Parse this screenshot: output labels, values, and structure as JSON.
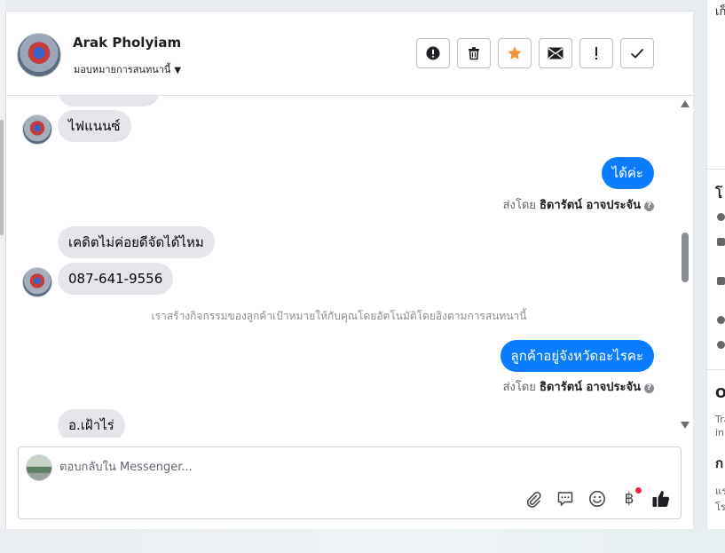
{
  "header": {
    "name": "Arak Pholyiam",
    "assign_label": "มอบหมายการสนทนานี้",
    "toolbar": [
      {
        "name": "spam-button",
        "icon": "alert-circle-icon"
      },
      {
        "name": "delete-button",
        "icon": "trash-icon"
      },
      {
        "name": "star-button",
        "icon": "star-icon"
      },
      {
        "name": "mark-unread-button",
        "icon": "envelope-icon"
      },
      {
        "name": "follow-up-button",
        "icon": "exclamation-icon"
      },
      {
        "name": "mark-done-button",
        "icon": "check-icon"
      }
    ]
  },
  "messages": {
    "m1": "ไฟแนนซ์",
    "m2": "ได้ค่ะ",
    "m2_sent_prefix": "ส่งโดย",
    "m2_sent_name": "ธิดารัตน์ อาจประจัน",
    "m3": "เคดิตไม่ค่อยดีจัดได้ไหม",
    "m4": "087-641-9556",
    "system_note": "เราสร้างกิจกรรมของลูกค้าเป้าหมายให้กับคุณโดยอัตโนมัติโดยอิงตามการสนทนานี้",
    "m5": "ลูกค้าอยู่จังหวัดอะไรคะ",
    "m5_sent_prefix": "ส่งโดย",
    "m5_sent_name": "ธิดารัตน์ อาจประจัน",
    "m6": "อ.เฝ้าไร่"
  },
  "composer": {
    "placeholder": "ตอบกลับใน Messenger...",
    "icons": [
      "paperclip-icon",
      "saved-reply-icon",
      "emoji-icon",
      "payment-baht-icon",
      "like-icon"
    ],
    "baht_symbol": "฿"
  },
  "right_panel": {
    "t1": "เก็",
    "t2": "โ",
    "t3": "O",
    "t4a": "Tra",
    "t4b": "in",
    "t5": "ก",
    "t6a": "แร",
    "t6b": "โร"
  },
  "colors": {
    "outgoing_bubble": "#0a7cff",
    "incoming_bubble": "#e4e6eb",
    "star": "#f7923b",
    "notification_dot": "#f02849"
  }
}
